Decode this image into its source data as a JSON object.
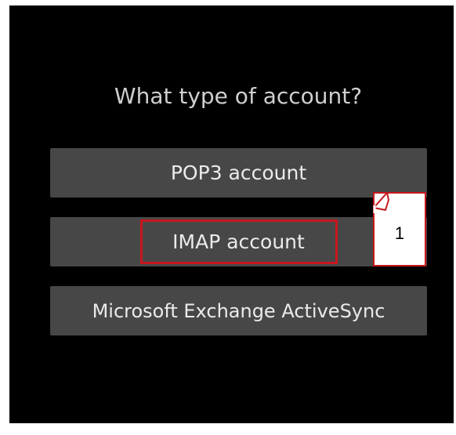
{
  "dialog": {
    "title": "What type of account?",
    "options": [
      {
        "label": "POP3 account"
      },
      {
        "label": "IMAP account"
      },
      {
        "label": "Microsoft Exchange ActiveSync"
      }
    ]
  },
  "annotation": {
    "step_number": "1",
    "color": "#c8161d"
  },
  "colors": {
    "screen_bg": "#000000",
    "button_bg": "#474747",
    "button_text": "#ebebeb",
    "title_text": "#cfcfcf"
  }
}
